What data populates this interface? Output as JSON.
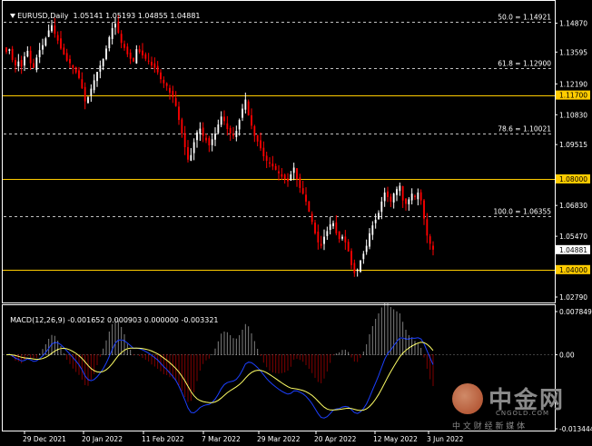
{
  "header": {
    "symbol_tf": "EURUSD,Daily",
    "ohlc": "1.05141 1.05193 1.04855 1.04881"
  },
  "macd_header": {
    "label": "MACD(12,26,9)",
    "values": "-0.001652 0.000903 0.000000 -0.003321"
  },
  "colors": {
    "background": "#000000",
    "bull_candle": "#ffffff",
    "bear_candle": "#ff0000",
    "level_line": "#ffcc00",
    "fib_line": "#c0c0c0",
    "macd_line": "#1c40ff",
    "signal_line": "#ffff66",
    "highlight_label_bg": "#ffcc00"
  },
  "chart_data": [
    {
      "type": "candlestick",
      "symbol": "EURUSD",
      "timeframe": "Daily",
      "ylim": [
        1.0255,
        1.1525
      ],
      "y_ticks": [
        "1.14870",
        "1.13595",
        "1.12190",
        "1.10830",
        "1.09515",
        "1.08000",
        "1.06830",
        "1.05470",
        "1.04881",
        "1.04000",
        "1.02790"
      ],
      "highlighted_ticks": [
        "1.11700",
        "1.08000",
        "1.04000"
      ],
      "current_price": "1.04881",
      "x_labels": [
        "29 Dec 2021",
        "20 Jan 2022",
        "11 Feb 2022",
        "7 Mar 2022",
        "29 Mar 2022",
        "20 Apr 2022",
        "12 May 2022",
        "3 Jun 2022"
      ],
      "horizontal_levels": [
        1.117,
        1.08,
        1.04
      ],
      "fib_levels": [
        {
          "label": "50.0 = 1.14921",
          "value": 1.14921
        },
        {
          "label": "61.8 = 1.12900",
          "value": 1.129
        },
        {
          "label": "78.6 = 1.10021",
          "value": 1.10021
        },
        {
          "label": "100.0 = 1.06355",
          "value": 1.06355
        }
      ],
      "closes": [
        1.136,
        1.1372,
        1.1325,
        1.1301,
        1.1318,
        1.1295,
        1.134,
        1.1365,
        1.131,
        1.129,
        1.1335,
        1.1368,
        1.139,
        1.142,
        1.1455,
        1.1478,
        1.144,
        1.141,
        1.1375,
        1.1348,
        1.1322,
        1.131,
        1.129,
        1.127,
        1.1245,
        1.12,
        1.1142,
        1.116,
        1.1198,
        1.1235,
        1.1272,
        1.13,
        1.133,
        1.1375,
        1.1425,
        1.1465,
        1.1485,
        1.1445,
        1.14,
        1.1378,
        1.135,
        1.133,
        1.1318,
        1.1372,
        1.136,
        1.1345,
        1.133,
        1.1318,
        1.13,
        1.129,
        1.127,
        1.124,
        1.1222,
        1.121,
        1.118,
        1.116,
        1.1122,
        1.106,
        1.1,
        1.094,
        1.0885,
        1.0905,
        1.0962,
        1.1005,
        1.1022,
        1.099,
        1.097,
        1.0948,
        1.0975,
        1.1,
        1.104,
        1.1075,
        1.1055,
        1.102,
        1.1,
        1.099,
        1.1012,
        1.106,
        1.111,
        1.115,
        1.108,
        1.1035,
        1.099,
        1.0965,
        1.0935,
        1.09,
        1.088,
        1.0868,
        1.0855,
        1.084,
        1.0825,
        1.081,
        1.08,
        1.079,
        1.082,
        1.085,
        1.08,
        1.076,
        1.0735,
        1.07,
        1.0655,
        1.061,
        1.056,
        1.052,
        1.0505,
        1.0545,
        1.057,
        1.06,
        1.0605,
        1.056,
        1.0535,
        1.0545,
        1.052,
        1.048,
        1.042,
        1.0385,
        1.04,
        1.044,
        1.047,
        1.0505,
        1.056,
        1.0595,
        1.062,
        1.065,
        1.07,
        1.074,
        1.072,
        1.07,
        1.0735,
        1.0755,
        1.077,
        1.0705,
        1.069,
        1.071,
        1.0735,
        1.072,
        1.074,
        1.0705,
        1.0625,
        1.055,
        1.0514,
        1.0488
      ]
    },
    {
      "type": "macd",
      "label": "MACD(12,26,9)",
      "params": [
        12,
        26,
        9
      ],
      "values": {
        "main": -0.001652,
        "signal": 0.000903,
        "level": 0.0,
        "histogram": -0.003321
      },
      "y_ticks": [
        "0.007849",
        "0.00",
        "-0.013444"
      ],
      "ylim": [
        -0.013444,
        0.007849
      ],
      "x_labels": [
        "29 Dec 2021",
        "20 Jan 2022",
        "11 Feb 2022",
        "7 Mar 2022",
        "29 Mar 2022",
        "20 Apr 2022",
        "12 May 2022",
        "3 Jun 2022"
      ]
    }
  ],
  "watermark": {
    "name": "中金网",
    "site": "CNGOLD.COM",
    "slogan": "中 文 财 经 新 媒 体"
  }
}
